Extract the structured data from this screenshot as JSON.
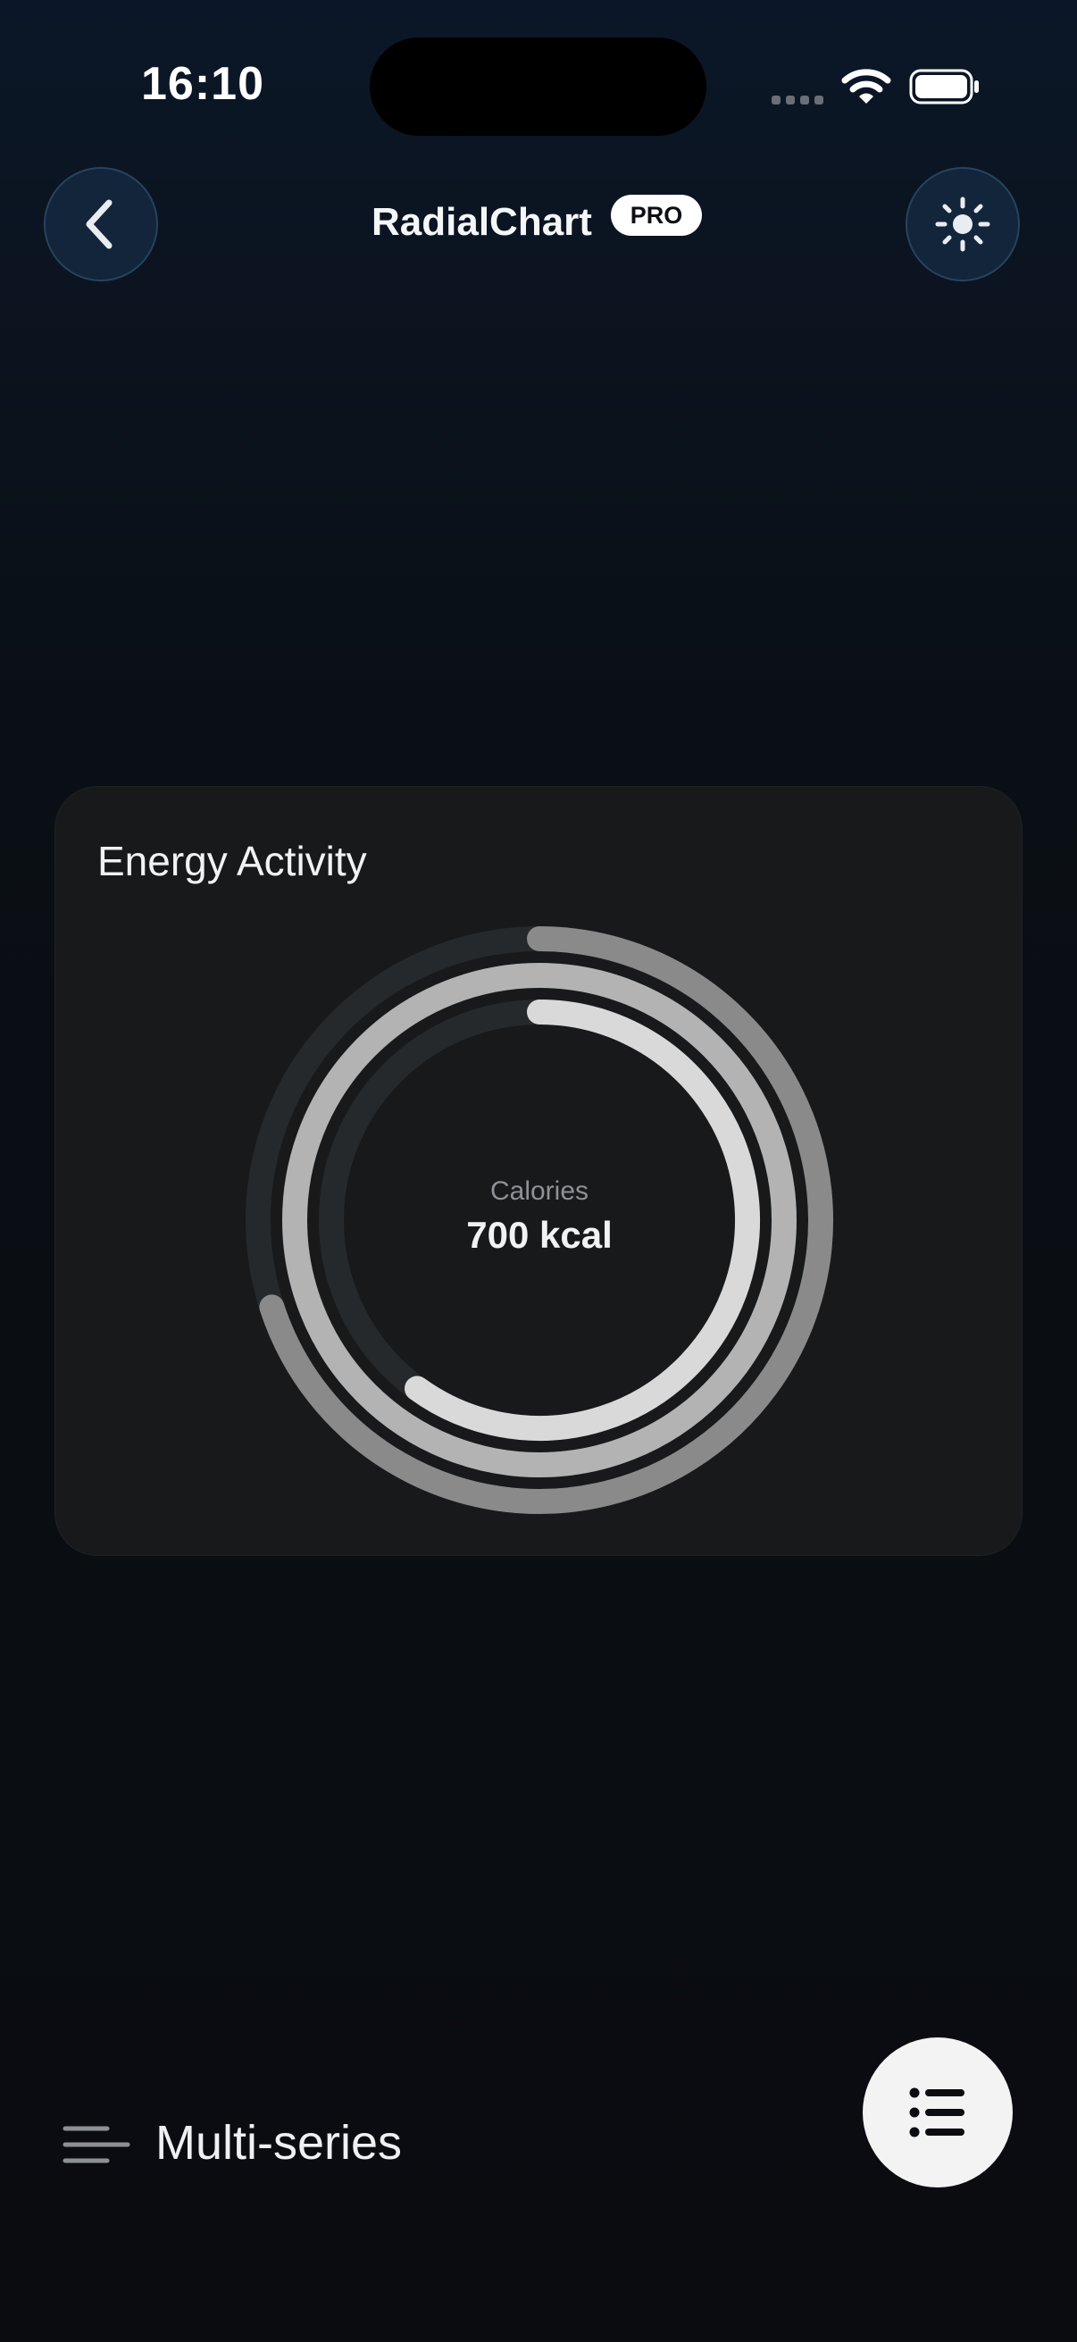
{
  "status_bar": {
    "time": "16:10"
  },
  "nav": {
    "title": "RadialChart",
    "badge": "PRO"
  },
  "card": {
    "title": "Energy Activity",
    "center_label": "Calories",
    "center_value": "700 kcal"
  },
  "chart_data": {
    "type": "radial",
    "title": "Energy Activity",
    "series": [
      {
        "value": 0.7,
        "color": "#8a8a8a"
      },
      {
        "value": 1.0,
        "color": "#b3b3b3"
      },
      {
        "value": 0.6,
        "color": "#d9d9d9"
      }
    ],
    "track_color": "#25292b"
  },
  "bottom": {
    "series_label": "Multi-series"
  },
  "icons": {
    "back": "chevron-left-icon",
    "theme": "sun-icon",
    "menu": "lines-icon",
    "fab": "list-icon"
  },
  "colors": {
    "background": "#0a0c10",
    "card": "#17191b",
    "button": "#13253a",
    "fab": "#f3f3f3"
  }
}
